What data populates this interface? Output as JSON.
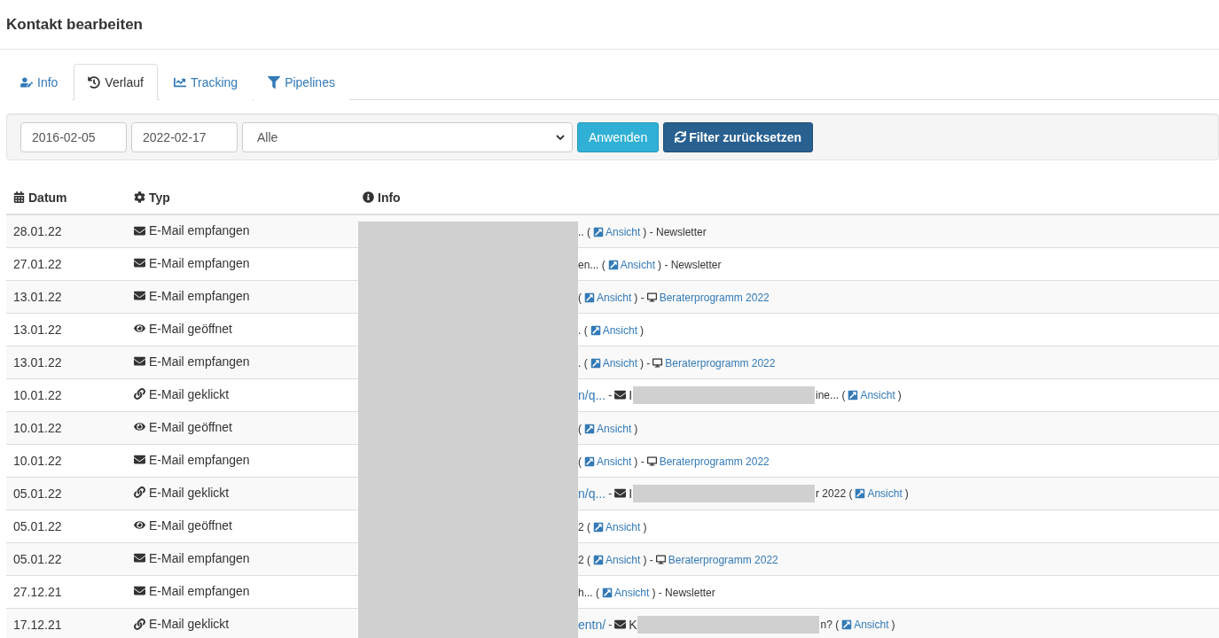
{
  "title": "Kontakt bearbeiten",
  "tabs": [
    {
      "label": "Info",
      "selected": false
    },
    {
      "label": "Verlauf",
      "selected": true
    },
    {
      "label": "Tracking",
      "selected": false
    },
    {
      "label": "Pipelines",
      "selected": false
    }
  ],
  "filter": {
    "date_from": "2016-02-05",
    "date_to": "2022-02-17",
    "type": "Alle",
    "apply": "Anwenden",
    "reset": "Filter zurücksetzen"
  },
  "table": {
    "columns": [
      "Datum",
      "Typ",
      "Info"
    ],
    "info_redacted": true,
    "rows": [
      {
        "date": "28.01.22",
        "kind": "received",
        "type": "E-Mail empfangen",
        "info": [
          {
            "kind": "text",
            "text": ".. ("
          },
          {
            "kind": "view",
            "text": "Ansicht"
          },
          {
            "kind": "text",
            "text": ") - Newsletter"
          }
        ]
      },
      {
        "date": "27.01.22",
        "kind": "received",
        "type": "E-Mail empfangen",
        "info": [
          {
            "kind": "text",
            "text": "en... ("
          },
          {
            "kind": "view",
            "text": "Ansicht"
          },
          {
            "kind": "text",
            "text": ") - Newsletter"
          }
        ]
      },
      {
        "date": "13.01.22",
        "kind": "received",
        "type": "E-Mail empfangen",
        "info": [
          {
            "kind": "text",
            "text": "("
          },
          {
            "kind": "view",
            "text": "Ansicht"
          },
          {
            "kind": "text",
            "text": ") -"
          },
          {
            "kind": "campaign",
            "text": "Beraterprogramm 2022"
          }
        ]
      },
      {
        "date": "13.01.22",
        "kind": "opened",
        "type": "E-Mail geöffnet",
        "info": [
          {
            "kind": "text",
            "text": ". ("
          },
          {
            "kind": "view",
            "text": "Ansicht"
          },
          {
            "kind": "text",
            "text": ")"
          }
        ]
      },
      {
        "date": "13.01.22",
        "kind": "received",
        "type": "E-Mail empfangen",
        "info": [
          {
            "kind": "text",
            "text": ". ("
          },
          {
            "kind": "view",
            "text": "Ansicht"
          },
          {
            "kind": "text",
            "text": ") -"
          },
          {
            "kind": "campaign",
            "text": "Beraterprogramm 2022"
          }
        ]
      },
      {
        "date": "10.01.22",
        "kind": "clicked",
        "type": "E-Mail geklickt",
        "info": [
          {
            "kind": "link",
            "text": "n/q..."
          },
          {
            "kind": "text",
            "text": "-"
          },
          {
            "kind": "mail",
            "text": "I"
          },
          {
            "kind": "redacted"
          },
          {
            "kind": "text",
            "text": "ine... ("
          },
          {
            "kind": "view",
            "text": "Ansicht"
          },
          {
            "kind": "text",
            "text": ")"
          }
        ]
      },
      {
        "date": "10.01.22",
        "kind": "opened",
        "type": "E-Mail geöffnet",
        "info": [
          {
            "kind": "text",
            "text": "("
          },
          {
            "kind": "view",
            "text": "Ansicht"
          },
          {
            "kind": "text",
            "text": ")"
          }
        ]
      },
      {
        "date": "10.01.22",
        "kind": "received",
        "type": "E-Mail empfangen",
        "info": [
          {
            "kind": "text",
            "text": "("
          },
          {
            "kind": "view",
            "text": "Ansicht"
          },
          {
            "kind": "text",
            "text": ") -"
          },
          {
            "kind": "campaign",
            "text": "Beraterprogramm 2022"
          }
        ]
      },
      {
        "date": "05.01.22",
        "kind": "clicked",
        "type": "E-Mail geklickt",
        "info": [
          {
            "kind": "link",
            "text": "n/q..."
          },
          {
            "kind": "text",
            "text": "-"
          },
          {
            "kind": "mail",
            "text": "I"
          },
          {
            "kind": "redacted"
          },
          {
            "kind": "text",
            "text": "r 2022 ("
          },
          {
            "kind": "view",
            "text": "Ansicht"
          },
          {
            "kind": "text",
            "text": ")"
          }
        ]
      },
      {
        "date": "05.01.22",
        "kind": "opened",
        "type": "E-Mail geöffnet",
        "info": [
          {
            "kind": "text",
            "text": "2 ("
          },
          {
            "kind": "view",
            "text": "Ansicht"
          },
          {
            "kind": "text",
            "text": ")"
          }
        ]
      },
      {
        "date": "05.01.22",
        "kind": "received",
        "type": "E-Mail empfangen",
        "info": [
          {
            "kind": "text",
            "text": "2 ("
          },
          {
            "kind": "view",
            "text": "Ansicht"
          },
          {
            "kind": "text",
            "text": ") -"
          },
          {
            "kind": "campaign",
            "text": "Beraterprogramm 2022"
          }
        ]
      },
      {
        "date": "27.12.21",
        "kind": "received",
        "type": "E-Mail empfangen",
        "info": [
          {
            "kind": "text",
            "text": "h... ("
          },
          {
            "kind": "view",
            "text": "Ansicht"
          },
          {
            "kind": "text",
            "text": ") - Newsletter"
          }
        ]
      },
      {
        "date": "17.12.21",
        "kind": "clicked",
        "type": "E-Mail geklickt",
        "info": [
          {
            "kind": "link",
            "text": "entn/"
          },
          {
            "kind": "text",
            "text": "-"
          },
          {
            "kind": "mail",
            "text": "K"
          },
          {
            "kind": "redacted"
          },
          {
            "kind": "text",
            "text": "n? ("
          },
          {
            "kind": "view",
            "text": "Ansicht"
          },
          {
            "kind": "text",
            "text": ")"
          }
        ]
      }
    ]
  }
}
